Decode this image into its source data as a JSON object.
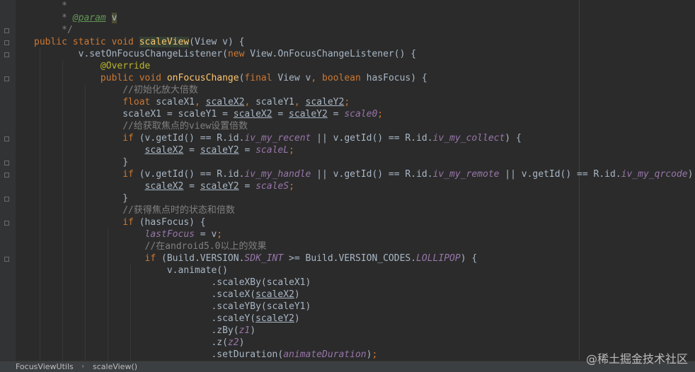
{
  "editor": {
    "lines": [
      [
        [
          "cm",
          "     *"
        ]
      ],
      [
        [
          "cm",
          "     * "
        ],
        [
          "tag",
          "@param"
        ],
        [
          "cm",
          " "
        ],
        [
          "caretbox",
          "v"
        ]
      ],
      [
        [
          "cm",
          "     */"
        ]
      ],
      [
        [
          "kw",
          "public static void "
        ],
        [
          "fn hl",
          "scaleView"
        ],
        [
          "",
          "(View v) {"
        ]
      ],
      [
        [
          "",
          "        v.setOnFocusChangeListener("
        ],
        [
          "kw",
          "new "
        ],
        [
          "",
          "View.OnFocusChangeListener() {"
        ]
      ],
      [
        [
          "ann",
          "            @Override"
        ]
      ],
      [
        [
          "kw",
          "            public void "
        ],
        [
          "fn",
          "onFocusChange"
        ],
        [
          "",
          "("
        ],
        [
          "kw",
          "final "
        ],
        [
          "",
          "View v"
        ],
        [
          "kw",
          ", boolean "
        ],
        [
          "",
          "hasFocus) {"
        ]
      ],
      [
        [
          "cm",
          "                //初始化放大倍数"
        ]
      ],
      [
        [
          "kw",
          "                float "
        ],
        [
          "",
          "scaleX1"
        ],
        [
          "kw",
          ", "
        ],
        [
          "ul",
          "scaleX2"
        ],
        [
          "kw",
          ", "
        ],
        [
          "",
          "scaleY1"
        ],
        [
          "kw",
          ", "
        ],
        [
          "ul",
          "scaleY2"
        ],
        [
          "kw",
          ";"
        ]
      ],
      [
        [
          "",
          "                scaleX1 = scaleY1 = "
        ],
        [
          "ul",
          "scaleX2"
        ],
        [
          "",
          " = "
        ],
        [
          "ul",
          "scaleY2"
        ],
        [
          "",
          " = "
        ],
        [
          "st",
          "scale0"
        ],
        [
          "kw",
          ";"
        ]
      ],
      [
        [
          "cm",
          "                //给获取焦点的view设置倍数"
        ]
      ],
      [
        [
          "kw",
          "                if "
        ],
        [
          "",
          "(v.getId() == R.id."
        ],
        [
          "st",
          "iv_my_recent"
        ],
        [
          "",
          " || v.getId() == R.id."
        ],
        [
          "st",
          "iv_my_collect"
        ],
        [
          "",
          ") {"
        ]
      ],
      [
        [
          "",
          "                    "
        ],
        [
          "ul",
          "scaleX2"
        ],
        [
          "",
          " = "
        ],
        [
          "ul",
          "scaleY2"
        ],
        [
          "",
          " = "
        ],
        [
          "st",
          "scaleL"
        ],
        [
          "kw",
          ";"
        ]
      ],
      [
        [
          "",
          "                }"
        ]
      ],
      [
        [
          "kw",
          "                if "
        ],
        [
          "",
          "(v.getId() == R.id."
        ],
        [
          "st",
          "iv_my_handle"
        ],
        [
          "",
          " || v.getId() == R.id."
        ],
        [
          "st",
          "iv_my_remote"
        ],
        [
          "",
          " || v.getId() == R.id."
        ],
        [
          "st",
          "iv_my_qrcode"
        ],
        [
          "",
          ") {"
        ]
      ],
      [
        [
          "",
          "                    "
        ],
        [
          "ul",
          "scaleX2"
        ],
        [
          "",
          " = "
        ],
        [
          "ul",
          "scaleY2"
        ],
        [
          "",
          " = "
        ],
        [
          "st",
          "scaleS"
        ],
        [
          "kw",
          ";"
        ]
      ],
      [
        [
          "",
          "                }"
        ]
      ],
      [
        [
          "cm",
          "                //获得焦点时的状态和倍数"
        ]
      ],
      [
        [
          "kw",
          "                if "
        ],
        [
          "",
          "(hasFocus) {"
        ]
      ],
      [
        [
          "st",
          "                    lastFocus"
        ],
        [
          "",
          " = v"
        ],
        [
          "kw",
          ";"
        ]
      ],
      [
        [
          "cm",
          "                    //在android5.0以上的效果"
        ]
      ],
      [
        [
          "kw",
          "                    if "
        ],
        [
          "",
          "(Build.VERSION."
        ],
        [
          "st",
          "SDK_INT"
        ],
        [
          "",
          " >= Build.VERSION_CODES."
        ],
        [
          "st",
          "LOLLIPOP"
        ],
        [
          "",
          ") {"
        ]
      ],
      [
        [
          "",
          "                        v.animate()"
        ]
      ],
      [
        [
          "",
          "                                .scaleXBy(scaleX1)"
        ]
      ],
      [
        [
          "",
          "                                .scaleX("
        ],
        [
          "ul",
          "scaleX2"
        ],
        [
          "",
          ")"
        ]
      ],
      [
        [
          "",
          "                                .scaleYBy(scaleY1)"
        ]
      ],
      [
        [
          "",
          "                                .scaleY("
        ],
        [
          "ul",
          "scaleY2"
        ],
        [
          "",
          ")"
        ]
      ],
      [
        [
          "",
          "                                .zBy("
        ],
        [
          "st",
          "z1"
        ],
        [
          "",
          ")"
        ]
      ],
      [
        [
          "",
          "                                .z("
        ],
        [
          "st",
          "z2"
        ],
        [
          "",
          ")"
        ]
      ],
      [
        [
          "",
          "                                .setDuration("
        ],
        [
          "st",
          "animateDuration"
        ],
        [
          "",
          ")"
        ],
        [
          "kw",
          ";"
        ]
      ]
    ]
  },
  "breadcrumb": {
    "file": "FocusViewUtils",
    "separator": "›",
    "method": "scaleView()"
  },
  "watermark": "@稀土掘金技术社区",
  "colors": {
    "background": "#2B2B2B",
    "keyword": "#CC7832",
    "method": "#FFC66D",
    "comment": "#808080",
    "annotation": "#BBB529",
    "static_field": "#9876AA",
    "text": "#A9B7C6"
  }
}
